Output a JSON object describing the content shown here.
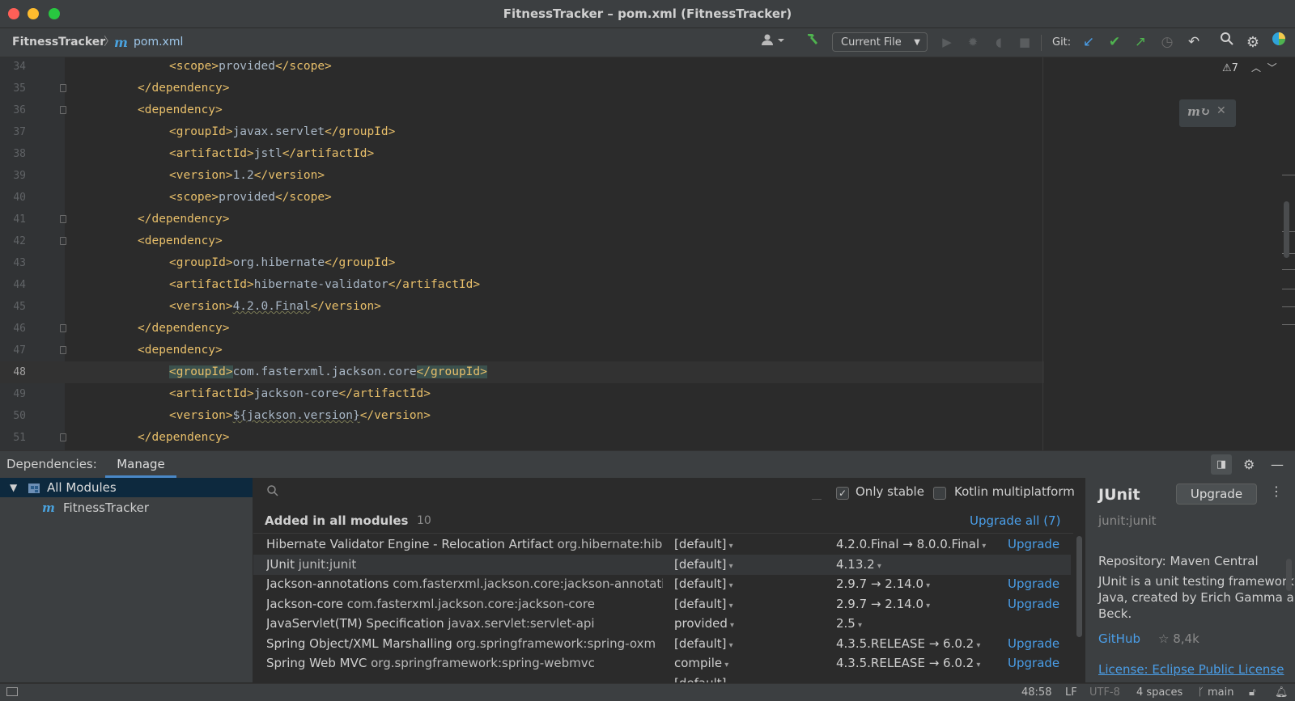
{
  "window": {
    "title": "FitnessTracker – pom.xml (FitnessTracker)"
  },
  "toolbar": {
    "project": "FitnessTracker",
    "file": "pom.xml",
    "file_icon": "m",
    "run_config": "Current File",
    "git_label": "Git:",
    "icons": [
      "account-icon",
      "build-hammer-icon",
      "run-icon",
      "debug-icon",
      "coverage-icon",
      "stop-icon",
      "git-update-icon",
      "git-commit-icon",
      "git-push-icon",
      "history-icon",
      "rollback-icon",
      "search-icon",
      "settings-icon",
      "jetbrains-logo-icon"
    ],
    "colors": {
      "hammer": "#4fb34f",
      "git_update": "#4a9ee8",
      "git_commit": "#4fb34f",
      "git_push": "#4fb34f"
    }
  },
  "editor": {
    "warnings": "7",
    "lines": [
      {
        "num": "34",
        "indent": 2,
        "open": "<scope>",
        "text": "provided",
        "close": "</scope>"
      },
      {
        "num": "35",
        "indent": 1,
        "fold": true,
        "open": "</dependency>"
      },
      {
        "num": "36",
        "indent": 1,
        "fold": true,
        "open": "<dependency>"
      },
      {
        "num": "37",
        "indent": 2,
        "open": "<groupId>",
        "text": "javax.servlet",
        "close": "</groupId>"
      },
      {
        "num": "38",
        "indent": 2,
        "open": "<artifactId>",
        "text": "jstl",
        "close": "</artifactId>"
      },
      {
        "num": "39",
        "indent": 2,
        "open": "<version>",
        "text": "1.2",
        "close": "</version>"
      },
      {
        "num": "40",
        "indent": 2,
        "open": "<scope>",
        "text": "provided",
        "close": "</scope>"
      },
      {
        "num": "41",
        "indent": 1,
        "fold": true,
        "open": "</dependency>"
      },
      {
        "num": "42",
        "indent": 1,
        "fold": true,
        "open": "<dependency>"
      },
      {
        "num": "43",
        "indent": 2,
        "open": "<groupId>",
        "text": "org.hibernate",
        "close": "</groupId>"
      },
      {
        "num": "44",
        "indent": 2,
        "open": "<artifactId>",
        "text": "hibernate-validator",
        "close": "</artifactId>"
      },
      {
        "num": "45",
        "indent": 2,
        "open": "<version>",
        "text": "4.2.0.Final",
        "close": "</version>",
        "wavy": true
      },
      {
        "num": "46",
        "indent": 1,
        "fold": true,
        "open": "</dependency>"
      },
      {
        "num": "47",
        "indent": 1,
        "fold": true,
        "open": "<dependency>"
      },
      {
        "num": "48",
        "indent": 2,
        "open": "<groupId>",
        "text": "com.fasterxml.jackson.core",
        "close": "</groupId>",
        "current": true
      },
      {
        "num": "49",
        "indent": 2,
        "open": "<artifactId>",
        "text": "jackson-core",
        "close": "</artifactId>"
      },
      {
        "num": "50",
        "indent": 2,
        "open": "<version>",
        "text": "${jackson.version}",
        "close": "</version>",
        "wavy": true
      },
      {
        "num": "51",
        "indent": 1,
        "fold": true,
        "open": "</dependency>"
      }
    ]
  },
  "deps": {
    "title": "Dependencies:",
    "tab_manage": "Manage",
    "modules": {
      "all": "All Modules",
      "project": "FitnessTracker"
    },
    "search_placeholder": "",
    "only_stable": "Only stable",
    "only_stable_checked": true,
    "kotlin": "Kotlin multiplatform",
    "kotlin_checked": false,
    "group_title": "Added in all modules",
    "group_count": "10",
    "upgrade_all": "Upgrade all (7)",
    "rows": [
      {
        "name": "Hibernate Validator Engine - Relocation Artifact",
        "id": "org.hibernate:hibernate-validator",
        "scope": "[default]",
        "version": "4.2.0.Final → 8.0.0.Final",
        "upgrade": "Upgrade"
      },
      {
        "name": "JUnit",
        "id": "junit:junit",
        "scope": "[default]",
        "version": "4.13.2",
        "upgrade": "",
        "selected": true
      },
      {
        "name": "Jackson-annotations",
        "id": "com.fasterxml.jackson.core:jackson-annotations",
        "scope": "[default]",
        "version": "2.9.7 → 2.14.0",
        "upgrade": "Upgrade"
      },
      {
        "name": "Jackson-core",
        "id": "com.fasterxml.jackson.core:jackson-core",
        "scope": "[default]",
        "version": "2.9.7 → 2.14.0",
        "upgrade": "Upgrade"
      },
      {
        "name": "JavaServlet(TM) Specification",
        "id": "javax.servlet:servlet-api",
        "scope": "provided",
        "version": "2.5",
        "upgrade": ""
      },
      {
        "name": "Spring Object/XML Marshalling",
        "id": "org.springframework:spring-oxm",
        "scope": "[default]",
        "version": "4.3.5.RELEASE → 6.0.2",
        "upgrade": "Upgrade"
      },
      {
        "name": "Spring Web MVC",
        "id": "org.springframework:spring-webmvc",
        "scope": "compile",
        "version": "4.3.5.RELEASE → 6.0.2",
        "upgrade": "Upgrade"
      },
      {
        "name": "",
        "id": "",
        "scope": "[default]",
        "version": "",
        "upgrade": ""
      }
    ],
    "details": {
      "title": "JUnit",
      "upgrade_btn": "Upgrade",
      "coords": "junit:junit",
      "repository": "Repository: Maven Central",
      "description": "JUnit is a unit testing framework for Java, created by Erich Gamma and Kent Beck.",
      "github": "GitHub",
      "stars": "☆ 8,4k",
      "license": "License: Eclipse Public License"
    }
  },
  "status": {
    "position": "48:58",
    "line_sep": "LF",
    "encoding": "UTF-8",
    "indent": "4 spaces",
    "branch": "main"
  }
}
